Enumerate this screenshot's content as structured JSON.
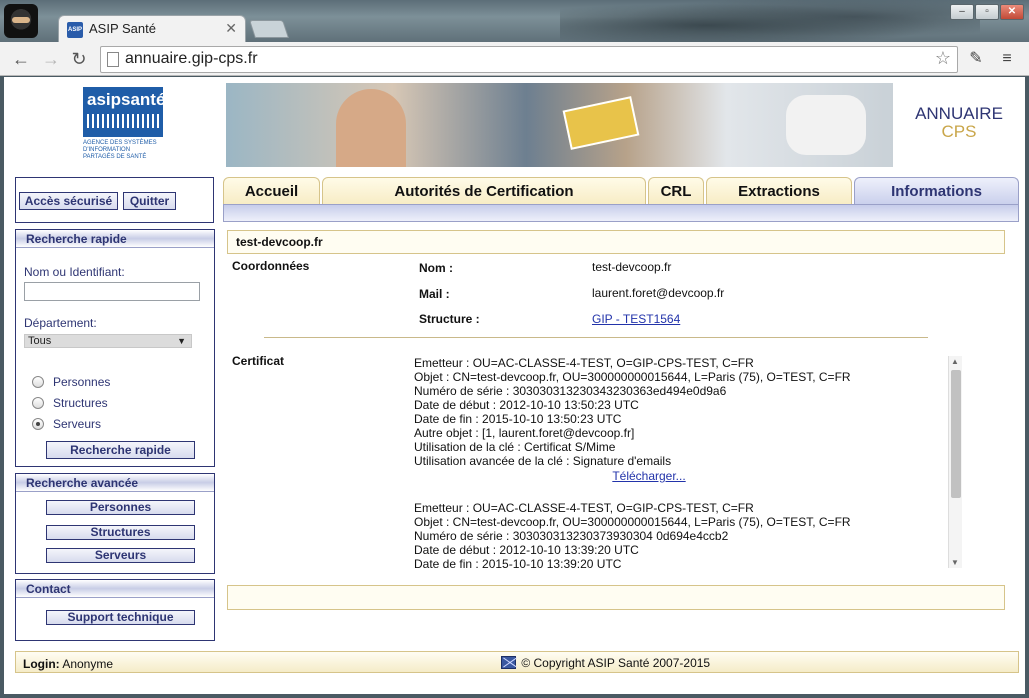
{
  "browser": {
    "tab_title": "ASIP Santé",
    "favicon_text": "ASIP",
    "url": "annuaire.gip-cps.fr"
  },
  "header": {
    "logo_text": "asipsanté",
    "logo_subtitle": "AGENCE DES SYSTÈMES D'INFORMATION PARTAGÉS DE SANTÉ",
    "annuaire_line1": "ANNUAIRE",
    "annuaire_line2": "CPS"
  },
  "auth": {
    "secure_access": "Accès sécurisé",
    "quit": "Quitter"
  },
  "quick_search": {
    "title": "Recherche rapide",
    "name_label": "Nom ou Identifiant:",
    "name_value": "",
    "dept_label": "Département:",
    "dept_value": "Tous",
    "options": [
      "Personnes",
      "Structures",
      "Serveurs"
    ],
    "selected_option": "Serveurs",
    "submit": "Recherche rapide"
  },
  "advanced_search": {
    "title": "Recherche avancée",
    "buttons": [
      "Personnes",
      "Structures",
      "Serveurs"
    ]
  },
  "contact": {
    "title": "Contact",
    "support": "Support technique"
  },
  "nav_tabs": [
    {
      "label": "Accueil",
      "active": false
    },
    {
      "label": "Autorités de Certification",
      "active": false
    },
    {
      "label": "CRL",
      "active": false
    },
    {
      "label": "Extractions",
      "active": false
    },
    {
      "label": "Informations",
      "active": true
    }
  ],
  "detail": {
    "title": "test-devcoop.fr",
    "coordonnees_label": "Coordonnées",
    "fields": [
      {
        "label": "Nom :",
        "value": "test-devcoop.fr",
        "link": false
      },
      {
        "label": "Mail :",
        "value": "laurent.foret@devcoop.fr",
        "link": false
      },
      {
        "label": "Structure :",
        "value": "GIP - TEST1564",
        "link": true
      }
    ],
    "certificat_label": "Certificat",
    "certificates": [
      {
        "lines": [
          "Emetteur : OU=AC-CLASSE-4-TEST, O=GIP-CPS-TEST, C=FR",
          "Objet : CN=test-devcoop.fr, OU=300000000015644, L=Paris (75), O=TEST, C=FR",
          "Numéro de série : 303030313230343230363ed494e0d9a6",
          "Date de début : 2012-10-10 13:50:23 UTC",
          "Date de fin : 2015-10-10 13:50:23 UTC",
          "Autre objet : [1, laurent.foret@devcoop.fr]",
          "Utilisation de la clé : Certificat S/Mime",
          "Utilisation avancée de la clé : Signature d'emails"
        ],
        "download": "Télécharger..."
      },
      {
        "lines": [
          "Emetteur : OU=AC-CLASSE-4-TEST, O=GIP-CPS-TEST, C=FR",
          "Objet : CN=test-devcoop.fr, OU=300000000015644, L=Paris (75), O=TEST, C=FR",
          "Numéro de série : 303030313230373930304 0d694e4ccb2",
          "Date de début : 2012-10-10 13:39:20 UTC",
          "Date de fin : 2015-10-10 13:39:20 UTC"
        ],
        "download": ""
      }
    ]
  },
  "footer": {
    "login_label": "Login:",
    "login_value": "Anonyme",
    "copyright": "© Copyright ASIP Santé 2007-2015"
  }
}
